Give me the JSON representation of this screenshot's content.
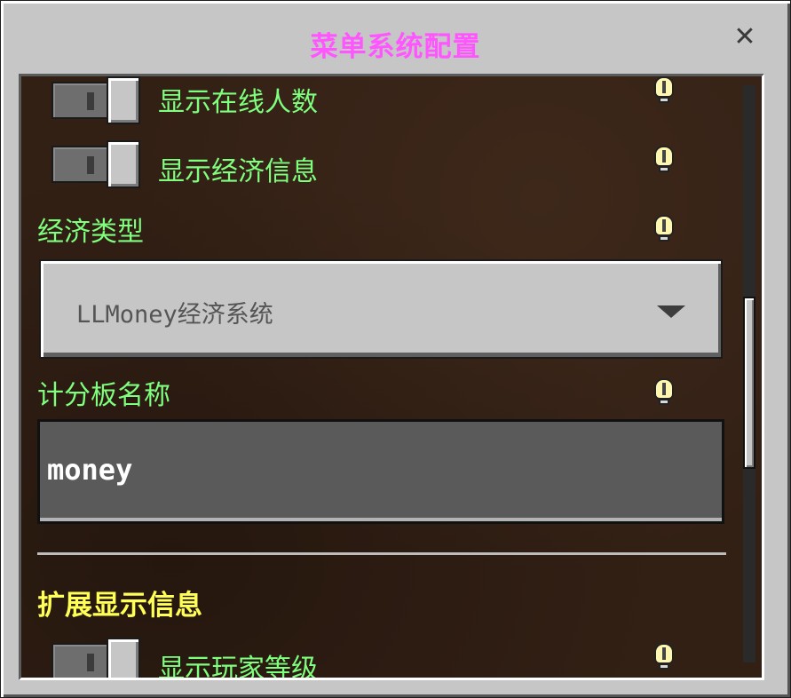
{
  "window": {
    "title": "菜单系统配置",
    "close_symbol": "✕"
  },
  "settings": {
    "toggle_online_count": {
      "label": "显示在线人数",
      "state": "off"
    },
    "toggle_economy_info": {
      "label": "显示经济信息",
      "state": "off"
    },
    "economy_type": {
      "label": "经济类型",
      "selected": "LLMoney经济系统"
    },
    "scoreboard_name": {
      "label": "计分板名称",
      "value": "money"
    },
    "extended_section": {
      "title": "扩展显示信息"
    },
    "toggle_player_level": {
      "label": "显示玩家等级",
      "state": "off"
    }
  },
  "colors": {
    "title": "#ff55ff",
    "setting_label": "#7eff7e",
    "section_title": "#ffff55",
    "panel_background": "#332015",
    "window_background": "#c6c6c6"
  },
  "icons": {
    "info": "info-bulb-icon",
    "dropdown": "chevron-down-icon",
    "close": "close-icon"
  }
}
